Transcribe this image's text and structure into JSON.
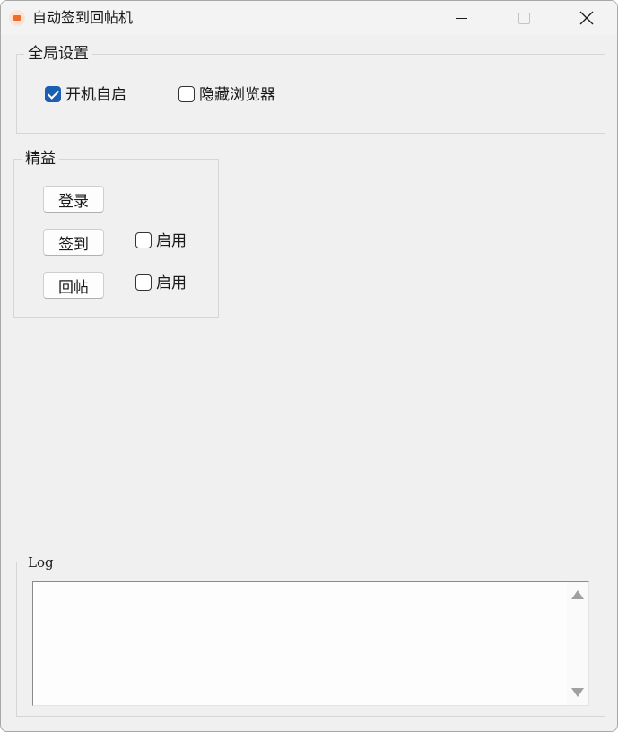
{
  "window": {
    "title": "自动签到回帖机",
    "icon": "app-icon"
  },
  "global_settings": {
    "legend": "全局设置",
    "autostart": {
      "label": "开机自启",
      "checked": true
    },
    "hide_browser": {
      "label": "隐藏浏览器",
      "checked": false
    }
  },
  "jingyi": {
    "legend": "精益",
    "login_button": "登录",
    "signin_button": "签到",
    "signin_enable": {
      "label": "启用",
      "checked": false
    },
    "reply_button": "回帖",
    "reply_enable": {
      "label": "启用",
      "checked": false
    }
  },
  "log": {
    "legend": "Log",
    "content": ""
  },
  "colors": {
    "accent": "#1a5fb4",
    "window_bg": "#f0f0f0"
  }
}
